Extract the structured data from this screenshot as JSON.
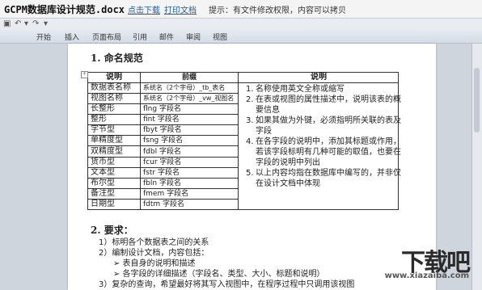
{
  "titlebar": {
    "doc_title": "GCPM数据库设计规范.docx",
    "download_link": "点击下载",
    "print_link": "打印文档",
    "tip": "提示：有文件修改权限，内容可以拷贝"
  },
  "ribbon": {
    "tabs": [
      "开始",
      "插入",
      "页面布局",
      "引用",
      "邮件",
      "审阅",
      "视图"
    ]
  },
  "document": {
    "section1_heading": "1.    命名规范",
    "table_headers": [
      "说明",
      "前缀",
      "说明"
    ],
    "rows": [
      [
        "数据表名称",
        "系统名（2个字母）_tb_表名"
      ],
      [
        "视图名称",
        "系统名（2个字母）_vw_视图名"
      ],
      [
        "长整形",
        "flng 字段名"
      ],
      [
        "整形",
        "fint 字段名"
      ],
      [
        "字节型",
        "fbyt 字段名"
      ],
      [
        "单精度型",
        "fsng 字段名"
      ],
      [
        "双精度型",
        "fdbl 字段名"
      ],
      [
        "货币型",
        "fcur 字段名"
      ],
      [
        "文本型",
        "fstr 字段名"
      ],
      [
        "布尔型",
        "fbln 字段名"
      ],
      [
        "备注型",
        "fmem 字段名"
      ],
      [
        "日期型",
        "fdtm 字段名"
      ]
    ],
    "notes": [
      "名称使用英文全称或缩写",
      "在表或视图的属性描述中，说明该表的概要信息",
      "如果其做为外键，必须指明所关联的表及字段",
      "在各字段的说明中，添加其标题或作用，若该字段标明有几种可能的取值，也要在字段的说明中列出",
      "以上内容均指在数据库中编写的，并非仅在设计文档中体现"
    ],
    "section2_heading": "2.    要求：",
    "requirements": [
      "1）标明各个数据表之间的关系",
      "2）编制设计文档，内容包括：",
      "➢  表自身的说明和描述",
      "➢  各字段的详细描述（字段名、类型、大小、标题和说明）",
      "3）复杂的查询，希望最好将其写入视图中，在程序过程中只调用该视图"
    ]
  },
  "watermark": {
    "logo_text": "下载吧",
    "url": "www.xiazaiba.com"
  }
}
